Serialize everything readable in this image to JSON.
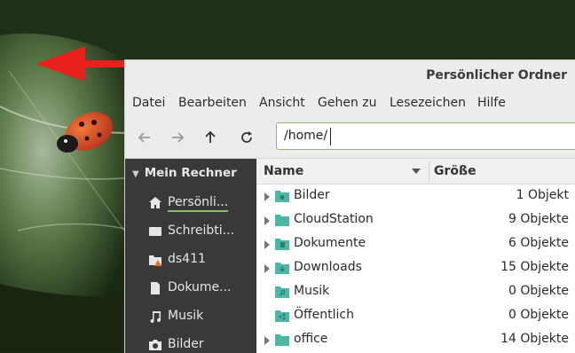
{
  "window": {
    "title": "Persönlicher Ordner"
  },
  "menubar": {
    "items": [
      "Datei",
      "Bearbeiten",
      "Ansicht",
      "Gehen zu",
      "Lesezeichen",
      "Hilfe"
    ]
  },
  "toolbar": {
    "back_icon": "arrow-left-icon",
    "forward_icon": "arrow-right-icon",
    "up_icon": "arrow-up-icon",
    "reload_icon": "reload-icon",
    "location": "/home/"
  },
  "sidebar": {
    "header": "Mein Rechner",
    "items": [
      {
        "label": "Persönli...",
        "icon": "home-icon",
        "active": true
      },
      {
        "label": "Schreibti...",
        "icon": "desktop-icon",
        "active": false
      },
      {
        "label": "ds411",
        "icon": "folder-warning-icon",
        "active": false
      },
      {
        "label": "Dokume...",
        "icon": "document-icon",
        "active": false
      },
      {
        "label": "Musik",
        "icon": "music-icon",
        "active": false
      },
      {
        "label": "Bilder",
        "icon": "camera-icon",
        "active": false
      }
    ]
  },
  "filelist": {
    "columns": {
      "name": "Name",
      "size": "Größe"
    },
    "rows": [
      {
        "name": "Bilder",
        "size": "1 Objekt",
        "expandable": true,
        "icon": "folder-pictures-icon"
      },
      {
        "name": "CloudStation",
        "size": "9 Objekte",
        "expandable": true,
        "icon": "folder-icon"
      },
      {
        "name": "Dokumente",
        "size": "6 Objekte",
        "expandable": true,
        "icon": "folder-documents-icon"
      },
      {
        "name": "Downloads",
        "size": "15 Objekte",
        "expandable": true,
        "icon": "folder-download-icon"
      },
      {
        "name": "Musik",
        "size": "0 Objekte",
        "expandable": false,
        "icon": "folder-music-icon"
      },
      {
        "name": "Öffentlich",
        "size": "0 Objekte",
        "expandable": false,
        "icon": "folder-public-icon"
      },
      {
        "name": "office",
        "size": "14 Objekte",
        "expandable": true,
        "icon": "folder-icon"
      }
    ]
  },
  "colors": {
    "accent": "#8fb96a",
    "folder": "#4db6a4",
    "sidebar_bg": "#393939",
    "arrow": "#e8211c"
  }
}
